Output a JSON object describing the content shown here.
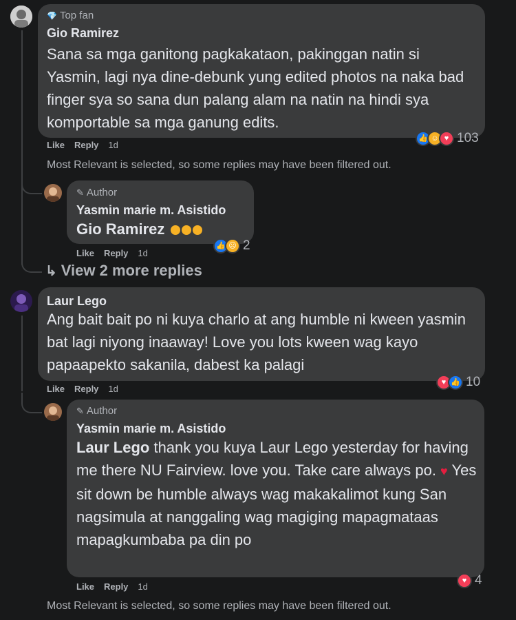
{
  "comments": [
    {
      "badge": "Top fan",
      "author": "Gio Ramirez",
      "text": "Sana sa mga ganitong pagkakataon, pakinggan natin si Yasmin, lagi nya dine-debunk yung edited photos na naka bad finger sya so sana dun palang alam na natin na hindi sya komportable sa mga ganung edits.",
      "like": "Like",
      "reply": "Reply",
      "time": "1d",
      "reaction_count": "103",
      "notice": "Most Relevant is selected, so some replies may have been filtered out.",
      "reply_comment": {
        "badge": "Author",
        "author": "Yasmin marie m. Asistido",
        "mention": "Gio Ramirez",
        "like": "Like",
        "reply": "Reply",
        "time": "1d",
        "reaction_count": "2"
      },
      "view_more": "View 2 more replies"
    },
    {
      "author": "Laur Lego",
      "text": "Ang bait bait po ni kuya charlo at ang humble ni kween yasmin bat lagi niyong inaaway! Love you lots kween wag kayo papaapekto sakanila, dabest ka palagi",
      "like": "Like",
      "reply": "Reply",
      "time": "1d",
      "reaction_count": "10",
      "reply_comment": {
        "badge": "Author",
        "author": "Yasmin marie m. Asistido",
        "mention": "Laur Lego",
        "text_1": " thank you kuya Laur Lego yesterday for having me there NU Fairview. love you. Take care always po. ",
        "text_2": " Yes sit down be humble always wag makakalimot kung San nagsimula at nanggaling wag magiging mapagmataas mapagkumbaba pa din po",
        "like": "Like",
        "reply": "Reply",
        "time": "1d",
        "reaction_count": "4"
      },
      "notice": "Most Relevant is selected, so some replies may have been filtered out."
    }
  ]
}
